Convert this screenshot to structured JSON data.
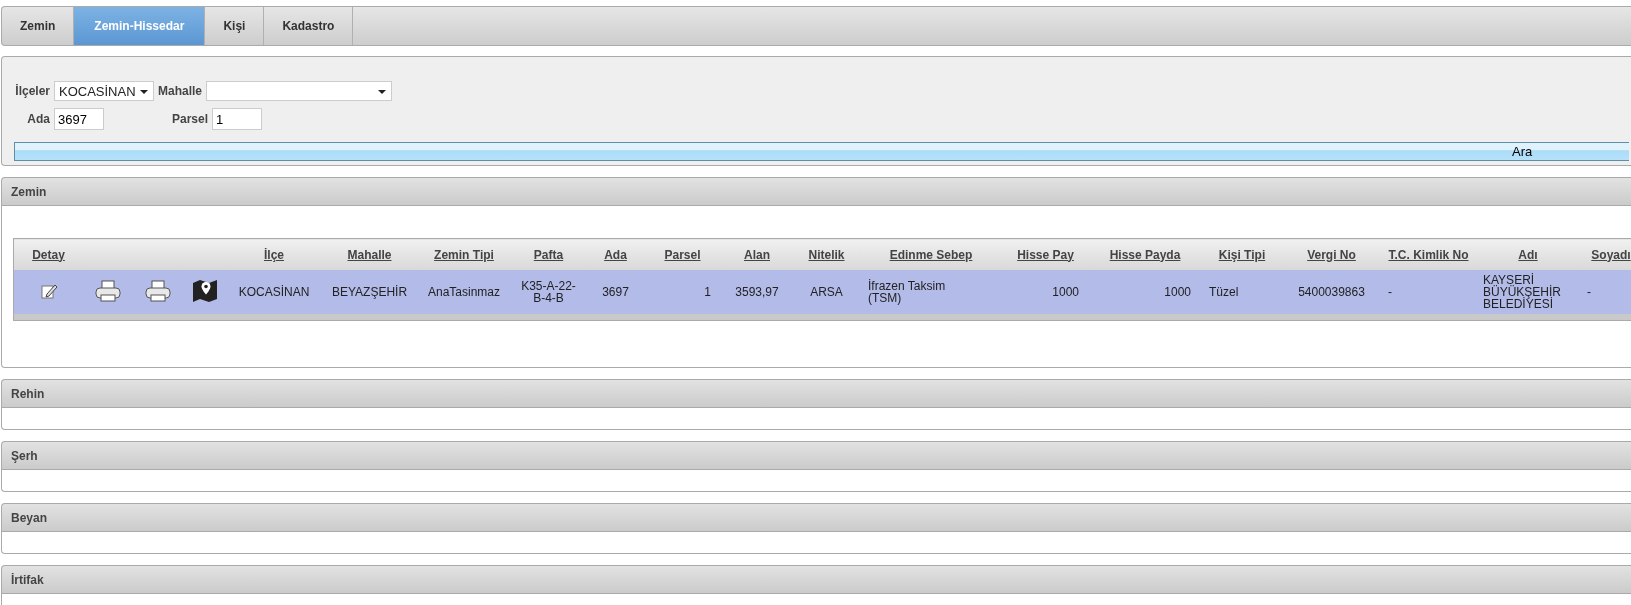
{
  "tabs": [
    {
      "label": "Zemin",
      "selected": false
    },
    {
      "label": "Zemin-Hissedar",
      "selected": true
    },
    {
      "label": "Kişi",
      "selected": false
    },
    {
      "label": "Kadastro",
      "selected": false
    }
  ],
  "filter": {
    "ilce": {
      "label": "İlçeler",
      "value": "KOCASİNAN"
    },
    "mahalle": {
      "label": "Mahalle"
    },
    "ada": {
      "label": "Ada",
      "value": "3697"
    },
    "parsel": {
      "label": "Parsel",
      "value": "1"
    },
    "button": "Ara"
  },
  "sections": [
    {
      "title": "Zemin",
      "kind": "table",
      "table": {
        "columns": [
          "Detay",
          "",
          "",
          "",
          "İlçe",
          "Mahalle",
          "Zemin Tipi",
          "Pafta",
          "Ada",
          "Parsel",
          "Alan",
          "Nitelik",
          "Edinme Sebep",
          "Hisse Pay",
          "Hisse Payda",
          "Kişi Tipi",
          "Vergi No",
          "T.C. Kimlik No",
          "Adı",
          "Soyadı"
        ],
        "rows": [
          {
            "selected": true,
            "cells": [
              {
                "kind": "edit"
              },
              {
                "kind": "print"
              },
              {
                "kind": "print"
              },
              {
                "kind": "map"
              },
              {
                "kind": "text",
                "text": "KOCASİNAN"
              },
              {
                "kind": "text",
                "text": "BEYAZŞEHİR"
              },
              {
                "kind": "text",
                "text": "AnaTasinmaz"
              },
              {
                "kind": "text",
                "text": "K35-A-22-B-4-B"
              },
              {
                "kind": "text",
                "text": "3697"
              },
              {
                "kind": "text",
                "text": "1"
              },
              {
                "kind": "text",
                "text": "3593,97"
              },
              {
                "kind": "text",
                "text": "ARSA"
              },
              {
                "kind": "text",
                "text": "İfrazen Taksim (TSM)"
              },
              {
                "kind": "text",
                "text": "1000"
              },
              {
                "kind": "text",
                "text": "1000"
              },
              {
                "kind": "text",
                "text": "Tüzel"
              },
              {
                "kind": "text",
                "text": "5400039863"
              },
              {
                "kind": "text",
                "text": "-"
              },
              {
                "kind": "text",
                "text": "KAYSERİ BÜYÜKŞEHİR BELEDİYESİ"
              },
              {
                "kind": "text",
                "text": "-"
              }
            ]
          }
        ]
      }
    },
    {
      "title": "Rehin",
      "kind": "empty"
    },
    {
      "title": "Şerh",
      "kind": "empty"
    },
    {
      "title": "Beyan",
      "kind": "empty"
    },
    {
      "title": "İrtifak",
      "kind": "empty"
    }
  ]
}
